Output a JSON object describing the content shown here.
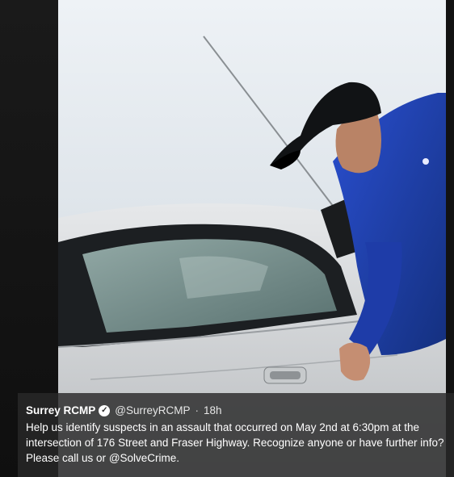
{
  "tweet": {
    "author_name": "Surrey RCMP",
    "verified_icon": "verified-badge-icon",
    "handle": "@SurreyRCMP",
    "separator": "·",
    "time": "18h",
    "text_line1": "Help us identify suspects in an assault that occurred on May 2nd at 6:30pm at the",
    "text_line2": "intersection of 176 Street and Fraser Highway. Recognize anyone or have further info?",
    "text_line3_prefix": "Please call us or ",
    "mention": "@SolveCrime",
    "text_line3_suffix": "."
  },
  "colors": {
    "sky": "#dfe6ec",
    "jacket": "#1f3fb0",
    "car": "#d8dbde",
    "caption_bg": "#2a2a2a"
  }
}
